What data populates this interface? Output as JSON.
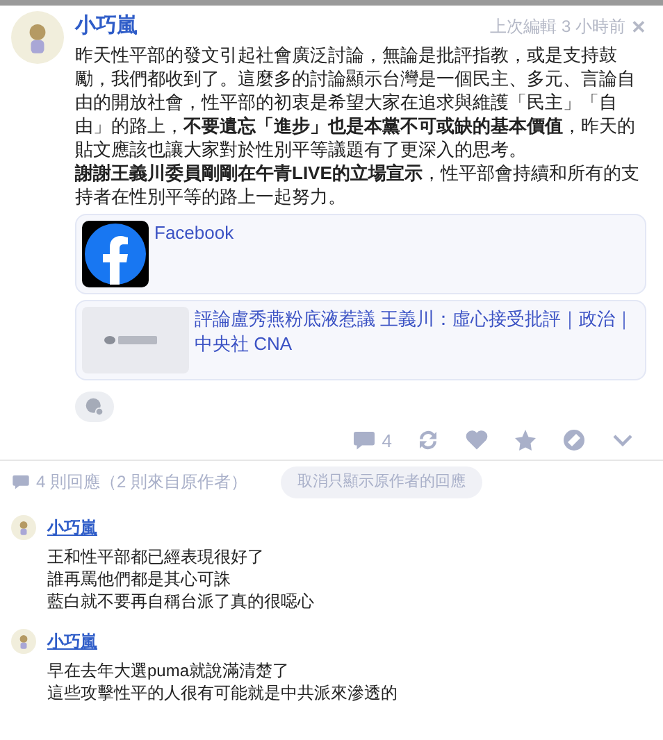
{
  "post": {
    "author": "小巧嵐",
    "time": "上次編輯 3 小時前",
    "close": "✕",
    "paragraphs": [
      "昨天性平部的發文引起社會廣泛討論，無論是批評指教，或是支持鼓勵，我們都收到了。這麼多的討論顯示台灣是一個民主、多元、言論自由的開放社會，性平部的初衷是希望大家在追求與維護「民主」「自由」的路上，**不要遺忘「進步」也是本黨不可或缺的基本價值**，昨天的貼文應該也讓大家對於性別平等議題有了更深入的思考。",
      "**謝謝王義川委員剛剛在午青LIVE的立場宣示**，性平部會持續和所有的支持者在性別平等的路上一起努力。"
    ],
    "links": [
      {
        "kind": "facebook",
        "title": "Facebook"
      },
      {
        "kind": "thumbnail",
        "title": "評論盧秀燕粉底液惹議 王義川：虛心接受批評｜政治｜中央社 CNA"
      }
    ],
    "comment_count": "4"
  },
  "comments_header": {
    "summary": "4 則回應（2 則來自原作者）",
    "toggle": "取消只顯示原作者的回應"
  },
  "comments": [
    {
      "author": "小巧嵐",
      "lines": [
        "王和性平部都已經表現很好了",
        "誰再罵他們都是其心可誅",
        "藍白就不要再自稱台派了真的很噁心"
      ]
    },
    {
      "author": "小巧嵐",
      "lines": [
        "早在去年大選puma就說滿清楚了",
        "這些攻擊性平的人很有可能就是中共派來滲透的"
      ]
    }
  ]
}
